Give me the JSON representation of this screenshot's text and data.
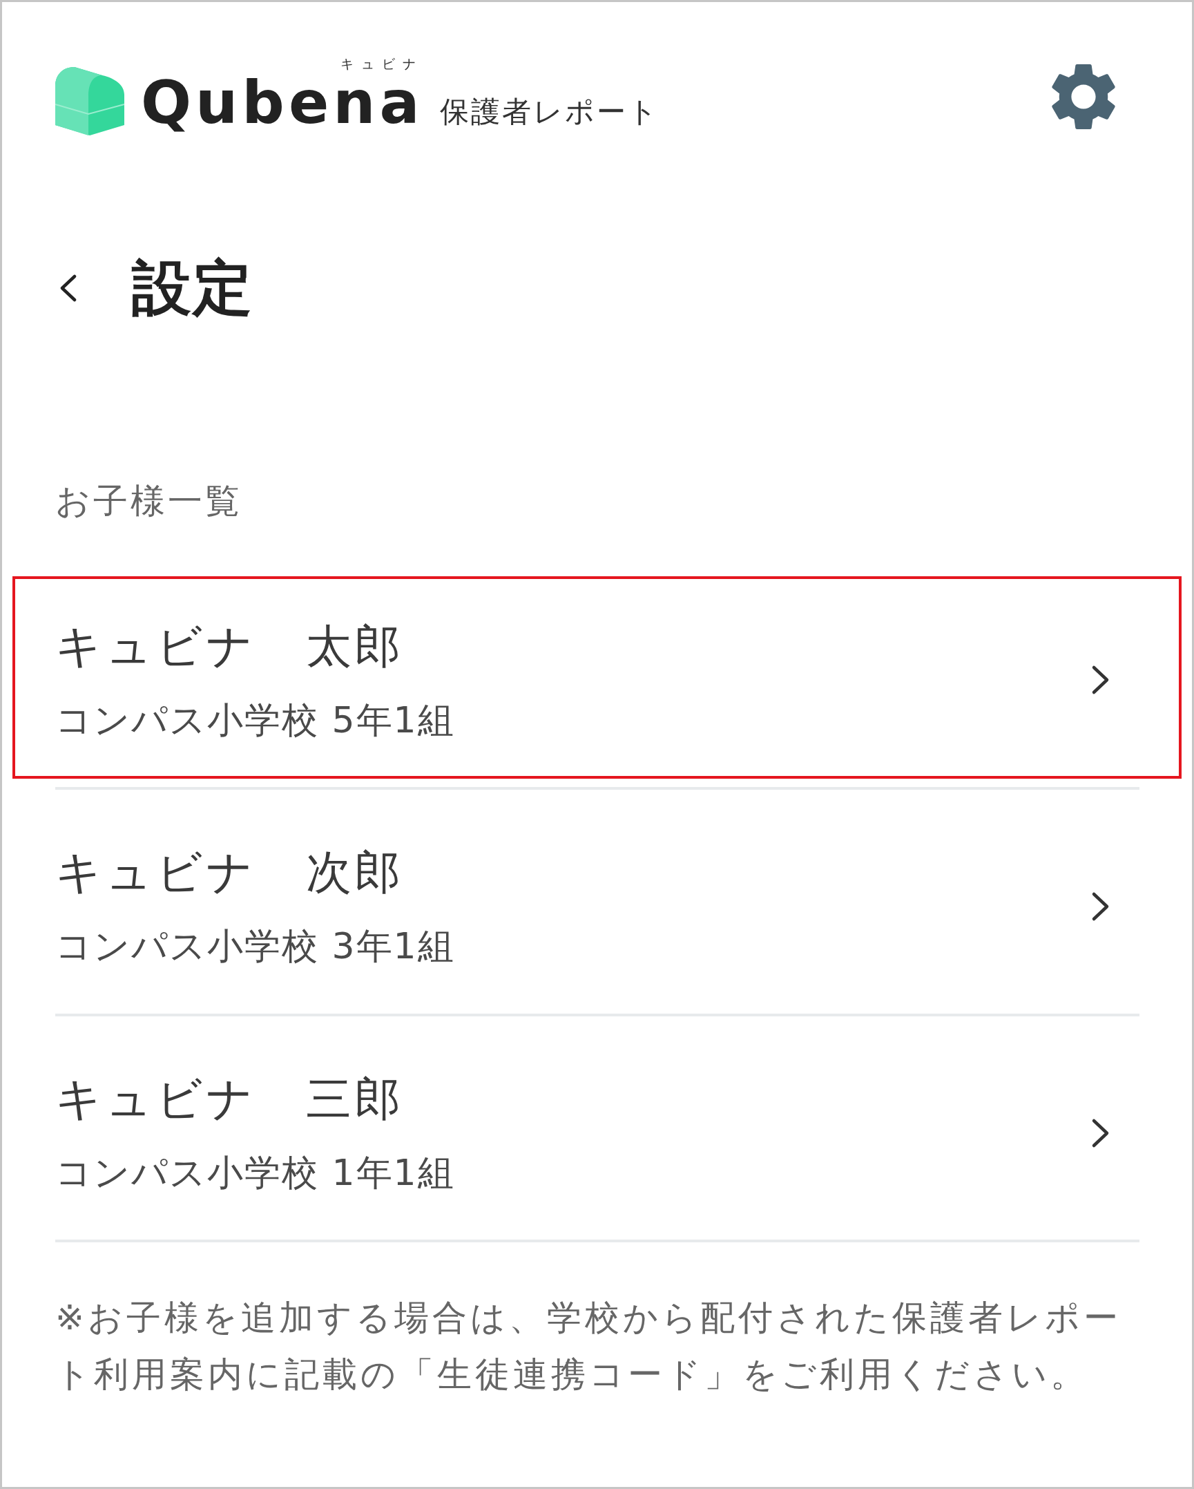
{
  "header": {
    "logo_reading": "キュビナ",
    "logo_wordmark": "Qubena",
    "subtitle": "保護者レポート"
  },
  "title_bar": {
    "title": "設定"
  },
  "children_list": {
    "heading": "お子様一覧",
    "items": [
      {
        "name": "キュビナ　太郎",
        "class_info": "コンパス小学校 5年1組",
        "highlighted": true
      },
      {
        "name": "キュビナ　次郎",
        "class_info": "コンパス小学校 3年1組",
        "highlighted": false
      },
      {
        "name": "キュビナ　三郎",
        "class_info": "コンパス小学校 1年1組",
        "highlighted": false
      }
    ]
  },
  "note": "※お子様を追加する場合は、学校から配付された保護者レポート利用案内に記載の「生徒連携コード」をご利用ください。"
}
